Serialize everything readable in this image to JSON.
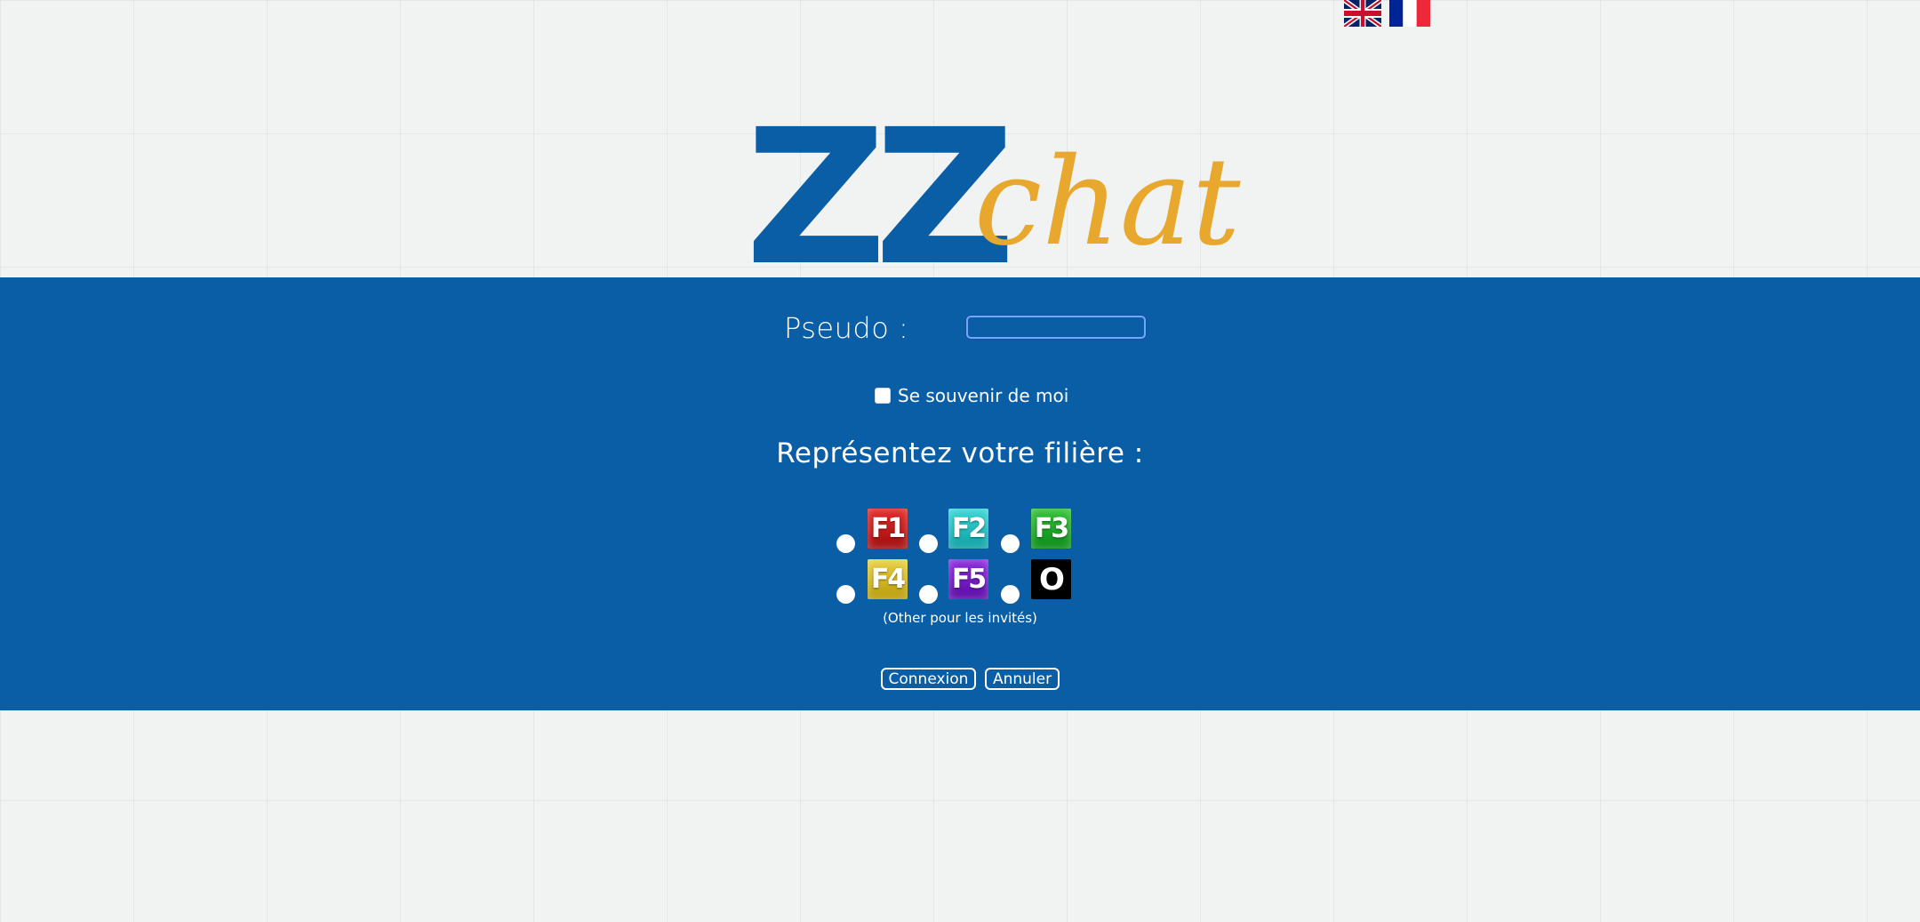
{
  "language_flags": [
    {
      "name": "English",
      "icon": "uk-flag-icon"
    },
    {
      "name": "Français",
      "icon": "france-flag-icon"
    }
  ],
  "logo": {
    "part1": "ZZ",
    "part2": "chat",
    "colors": {
      "zz": "#0a5ea6",
      "chat": "#e7a82d"
    }
  },
  "form": {
    "pseudo_label": "Pseudo :",
    "pseudo_value": "",
    "remember_label": "Se souvenir de moi",
    "remember_checked": false,
    "filiere_title": "Représentez votre filière :",
    "filieres": [
      {
        "label": "F1",
        "color": "#c4161c"
      },
      {
        "label": "F2",
        "color": "#1fbfc0"
      },
      {
        "label": "F3",
        "color": "#16a525"
      },
      {
        "label": "F4",
        "color": "#d4b619"
      },
      {
        "label": "F5",
        "color": "#7512c4"
      },
      {
        "label": "O",
        "color": "#000000"
      }
    ],
    "other_note": "(Other pour les invités)",
    "connexion_label": "Connexion",
    "annuler_label": "Annuler"
  },
  "colors": {
    "band": "#0a5ea6",
    "background": "#f1f2f2"
  }
}
